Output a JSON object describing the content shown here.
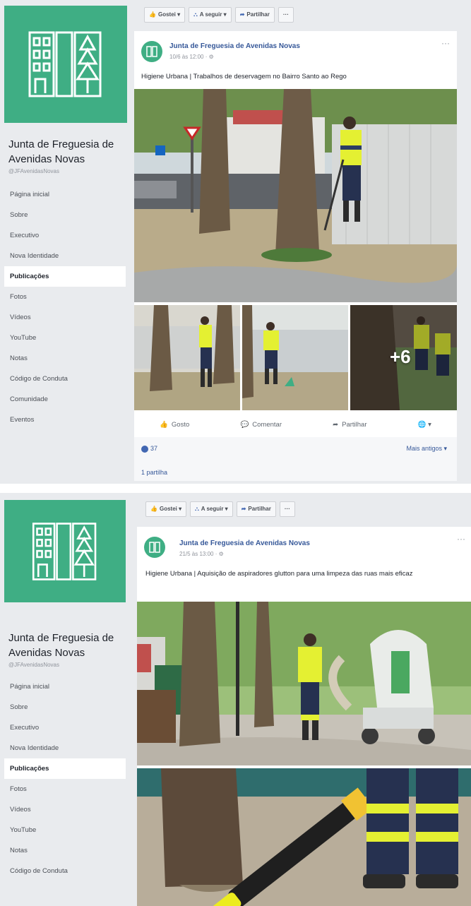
{
  "screenshots": [
    {
      "sidebar": {
        "page_name": "Junta de Freguesia de Avenidas Novas",
        "handle": "@JFAvenidasNovas",
        "items": [
          {
            "label": "Página inicial"
          },
          {
            "label": "Sobre"
          },
          {
            "label": "Executivo"
          },
          {
            "label": "Nova Identidade"
          },
          {
            "label": "Publicações",
            "active": true
          },
          {
            "label": "Fotos"
          },
          {
            "label": "Vídeos"
          },
          {
            "label": "YouTube"
          },
          {
            "label": "Notas"
          },
          {
            "label": "Código de Conduta"
          },
          {
            "label": "Comunidade"
          },
          {
            "label": "Eventos"
          }
        ]
      },
      "actions": {
        "like": "Gostei",
        "follow": "A seguir",
        "share": "Partilhar",
        "more": "···"
      },
      "post": {
        "author": "Junta de Freguesia de Avenidas Novas",
        "time": "10/6 às 12:00 · ⚙",
        "text": "Higiene Urbana | Trabalhos de deservagem no Bairro Santo ao Rego",
        "more_photos": "+6",
        "buttons": {
          "like": "Gosto",
          "comment": "Comentar",
          "share": "Partilhar"
        },
        "reactions": "37",
        "older": "Mais antigos ▾",
        "shares": "1 partilha"
      }
    },
    {
      "sidebar": {
        "page_name": "Junta de Freguesia de Avenidas Novas",
        "handle": "@JFAvenidasNovas",
        "items": [
          {
            "label": "Página inicial"
          },
          {
            "label": "Sobre"
          },
          {
            "label": "Executivo"
          },
          {
            "label": "Nova Identidade"
          },
          {
            "label": "Publicações",
            "active": true
          },
          {
            "label": "Fotos"
          },
          {
            "label": "Vídeos"
          },
          {
            "label": "YouTube"
          },
          {
            "label": "Notas"
          },
          {
            "label": "Código de Conduta"
          }
        ]
      },
      "actions": {
        "like": "Gostei",
        "follow": "A seguir",
        "share": "Partilhar",
        "more": "···"
      },
      "post": {
        "author": "Junta de Freguesia de Avenidas Novas",
        "time": "21/5 às 13:00 · ⚙",
        "text": "Higiene Urbana | Aquisição de aspiradores glutton para uma limpeza das ruas mais eficaz"
      }
    }
  ],
  "colors": {
    "brand_green": "#3fae84",
    "fb_blue": "#4267b2",
    "link_blue": "#365899"
  },
  "icons": [
    "logo-buildings-trees",
    "thumbs-up-icon",
    "follow-icon",
    "share-icon",
    "comment-icon",
    "globe-icon",
    "more-icon"
  ]
}
